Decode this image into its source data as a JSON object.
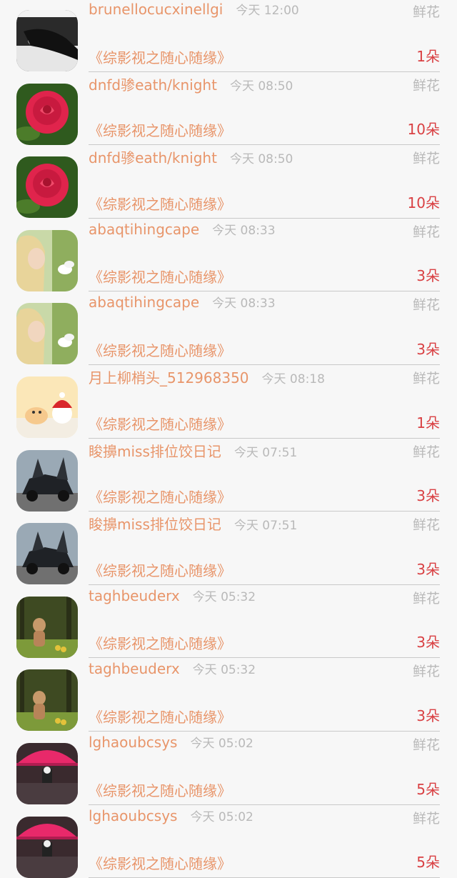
{
  "records": [
    {
      "avatar": "bw-photo-avatar",
      "username": "brunellocucxinellgi",
      "time": "今天 12:00",
      "gift_type": "鲜花",
      "novel": "《综影视之随心随缘》",
      "count": "1朵"
    },
    {
      "avatar": "rose-avatar",
      "username": "dnfd骖eath/knight",
      "time": "今天 08:50",
      "gift_type": "鲜花",
      "novel": "《综影视之随心随缘》",
      "count": "10朵"
    },
    {
      "avatar": "rose-avatar",
      "username": "dnfd骖eath/knight",
      "time": "今天 08:50",
      "gift_type": "鲜花",
      "novel": "《综影视之随心随缘》",
      "count": "10朵"
    },
    {
      "avatar": "blonde-woman-avatar",
      "username": "abaqtihingcape",
      "time": "今天 08:33",
      "gift_type": "鲜花",
      "novel": "《综影视之随心随缘》",
      "count": "3朵"
    },
    {
      "avatar": "blonde-woman-avatar",
      "username": "abaqtihingcape",
      "time": "今天 08:33",
      "gift_type": "鲜花",
      "novel": "《综影视之随心随缘》",
      "count": "3朵"
    },
    {
      "avatar": "cartoon-cats-avatar",
      "username": "月上柳梢头_512968350",
      "time": "今天 08:18",
      "gift_type": "鲜花",
      "novel": "《综影视之随心随缘》",
      "count": "1朵"
    },
    {
      "avatar": "sports-car-avatar",
      "username": "睃擤miss排位饺日记",
      "time": "今天 07:51",
      "gift_type": "鲜花",
      "novel": "《综影视之随心随缘》",
      "count": "3朵"
    },
    {
      "avatar": "sports-car-avatar",
      "username": "睃擤miss排位饺日记",
      "time": "今天 07:51",
      "gift_type": "鲜花",
      "novel": "《综影视之随心随缘》",
      "count": "3朵"
    },
    {
      "avatar": "child-forest-avatar",
      "username": "taghbeuderx",
      "time": "今天 05:32",
      "gift_type": "鲜花",
      "novel": "《综影视之随心随缘》",
      "count": "3朵"
    },
    {
      "avatar": "child-forest-avatar",
      "username": "taghbeuderx",
      "time": "今天 05:32",
      "gift_type": "鲜花",
      "novel": "《综影视之随心随缘》",
      "count": "3朵"
    },
    {
      "avatar": "red-umbrella-avatar",
      "username": "lghaoubcsys",
      "time": "今天 05:02",
      "gift_type": "鲜花",
      "novel": "《综影视之随心随缘》",
      "count": "5朵"
    },
    {
      "avatar": "red-umbrella-avatar",
      "username": "lghaoubcsys",
      "time": "今天 05:02",
      "gift_type": "鲜花",
      "novel": "《综影视之随心随缘》",
      "count": "5朵"
    }
  ]
}
